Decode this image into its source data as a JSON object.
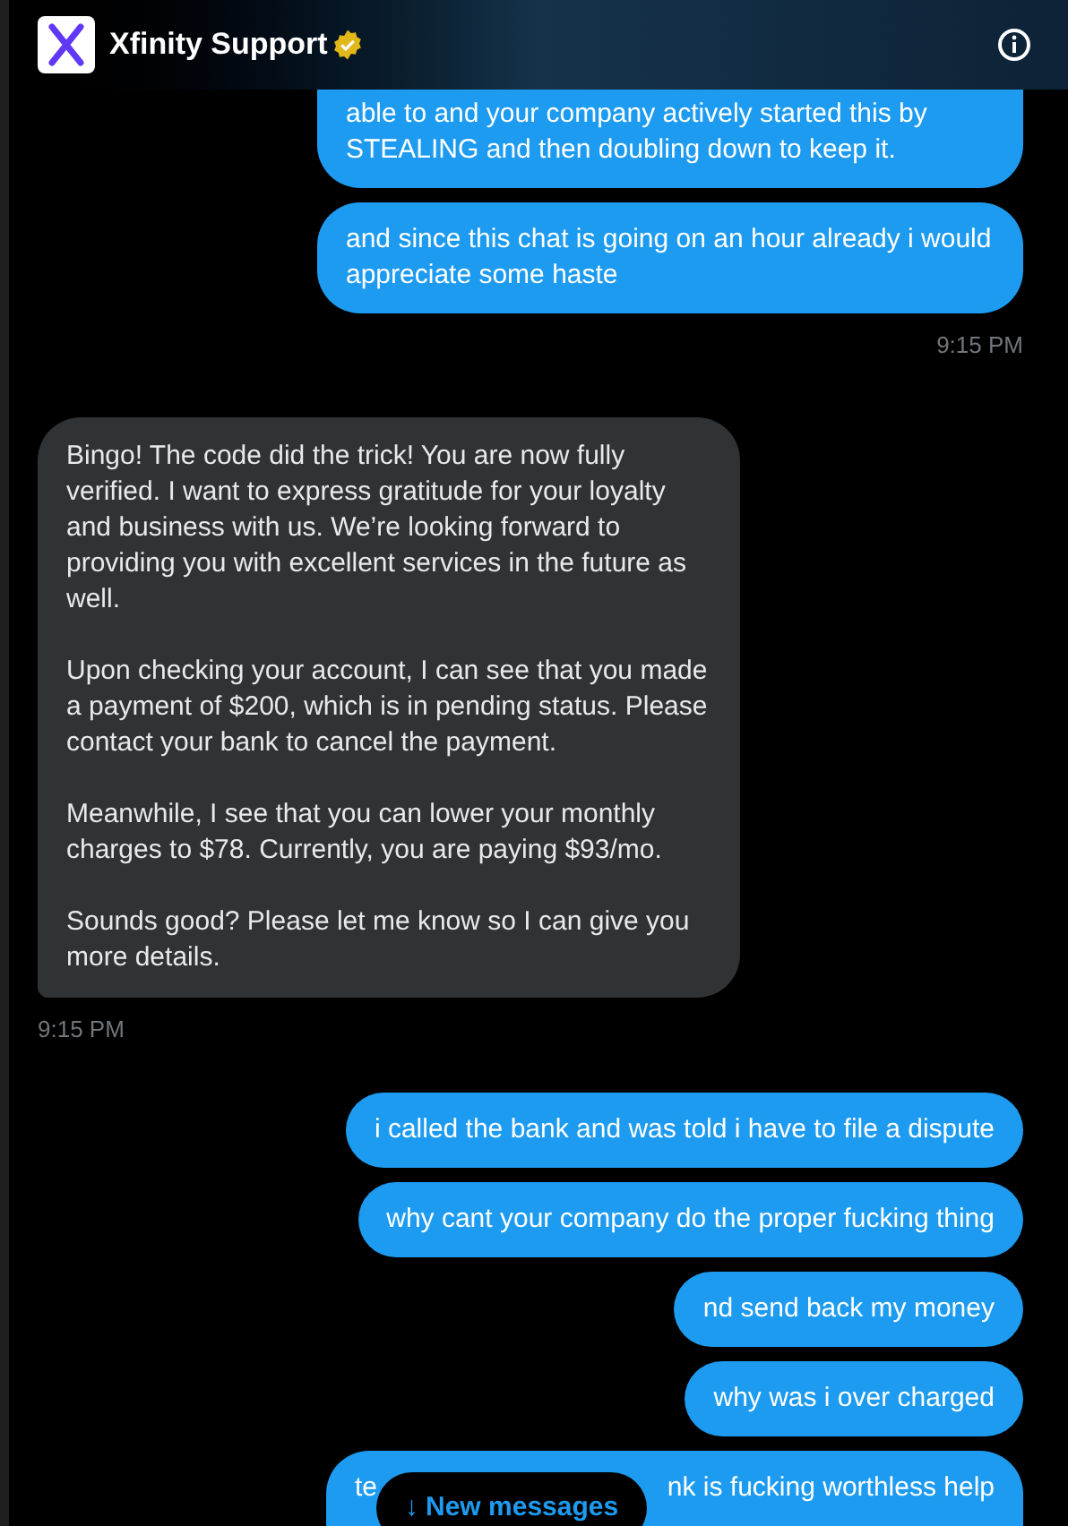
{
  "header": {
    "title": "Xfinity Support",
    "verified": true
  },
  "messages": [
    {
      "kind": "sent",
      "text": "able to and your company actively started this by STEALING and then doubling down to keep it.",
      "cut_top": true
    },
    {
      "kind": "sent",
      "text": "and since this chat is going on an hour already i would appreciate some haste"
    },
    {
      "kind": "sent_time",
      "text": "9:15 PM"
    },
    {
      "kind": "received",
      "paragraphs": [
        "Bingo! The code did the trick! You are now fully verified. I want to express gratitude for your loyalty and business with us. We’re looking forward to providing you with excellent services in the future as well.",
        "Upon checking your account, I can see that you made a payment of $200, which is in pending status. Please contact your bank to cancel the payment.",
        "Meanwhile, I see that you can lower your monthly charges to $78. Currently, you are paying $93/mo.",
        "Sounds good? Please let me know so I can give you more details."
      ]
    },
    {
      "kind": "received_time",
      "text": "9:15 PM"
    },
    {
      "kind": "sent",
      "text": "i called the bank and was told i have to file a dispute"
    },
    {
      "kind": "sent",
      "text": "why cant your company do the proper fucking thing"
    },
    {
      "kind": "sent",
      "text": "nd send back my money"
    },
    {
      "kind": "sent",
      "text": "why was i over charged"
    },
    {
      "kind": "covered",
      "before": "te",
      "after": "nk is fucking worthless help"
    }
  ],
  "new_messages": {
    "arrow": "↓",
    "label": "New messages"
  }
}
